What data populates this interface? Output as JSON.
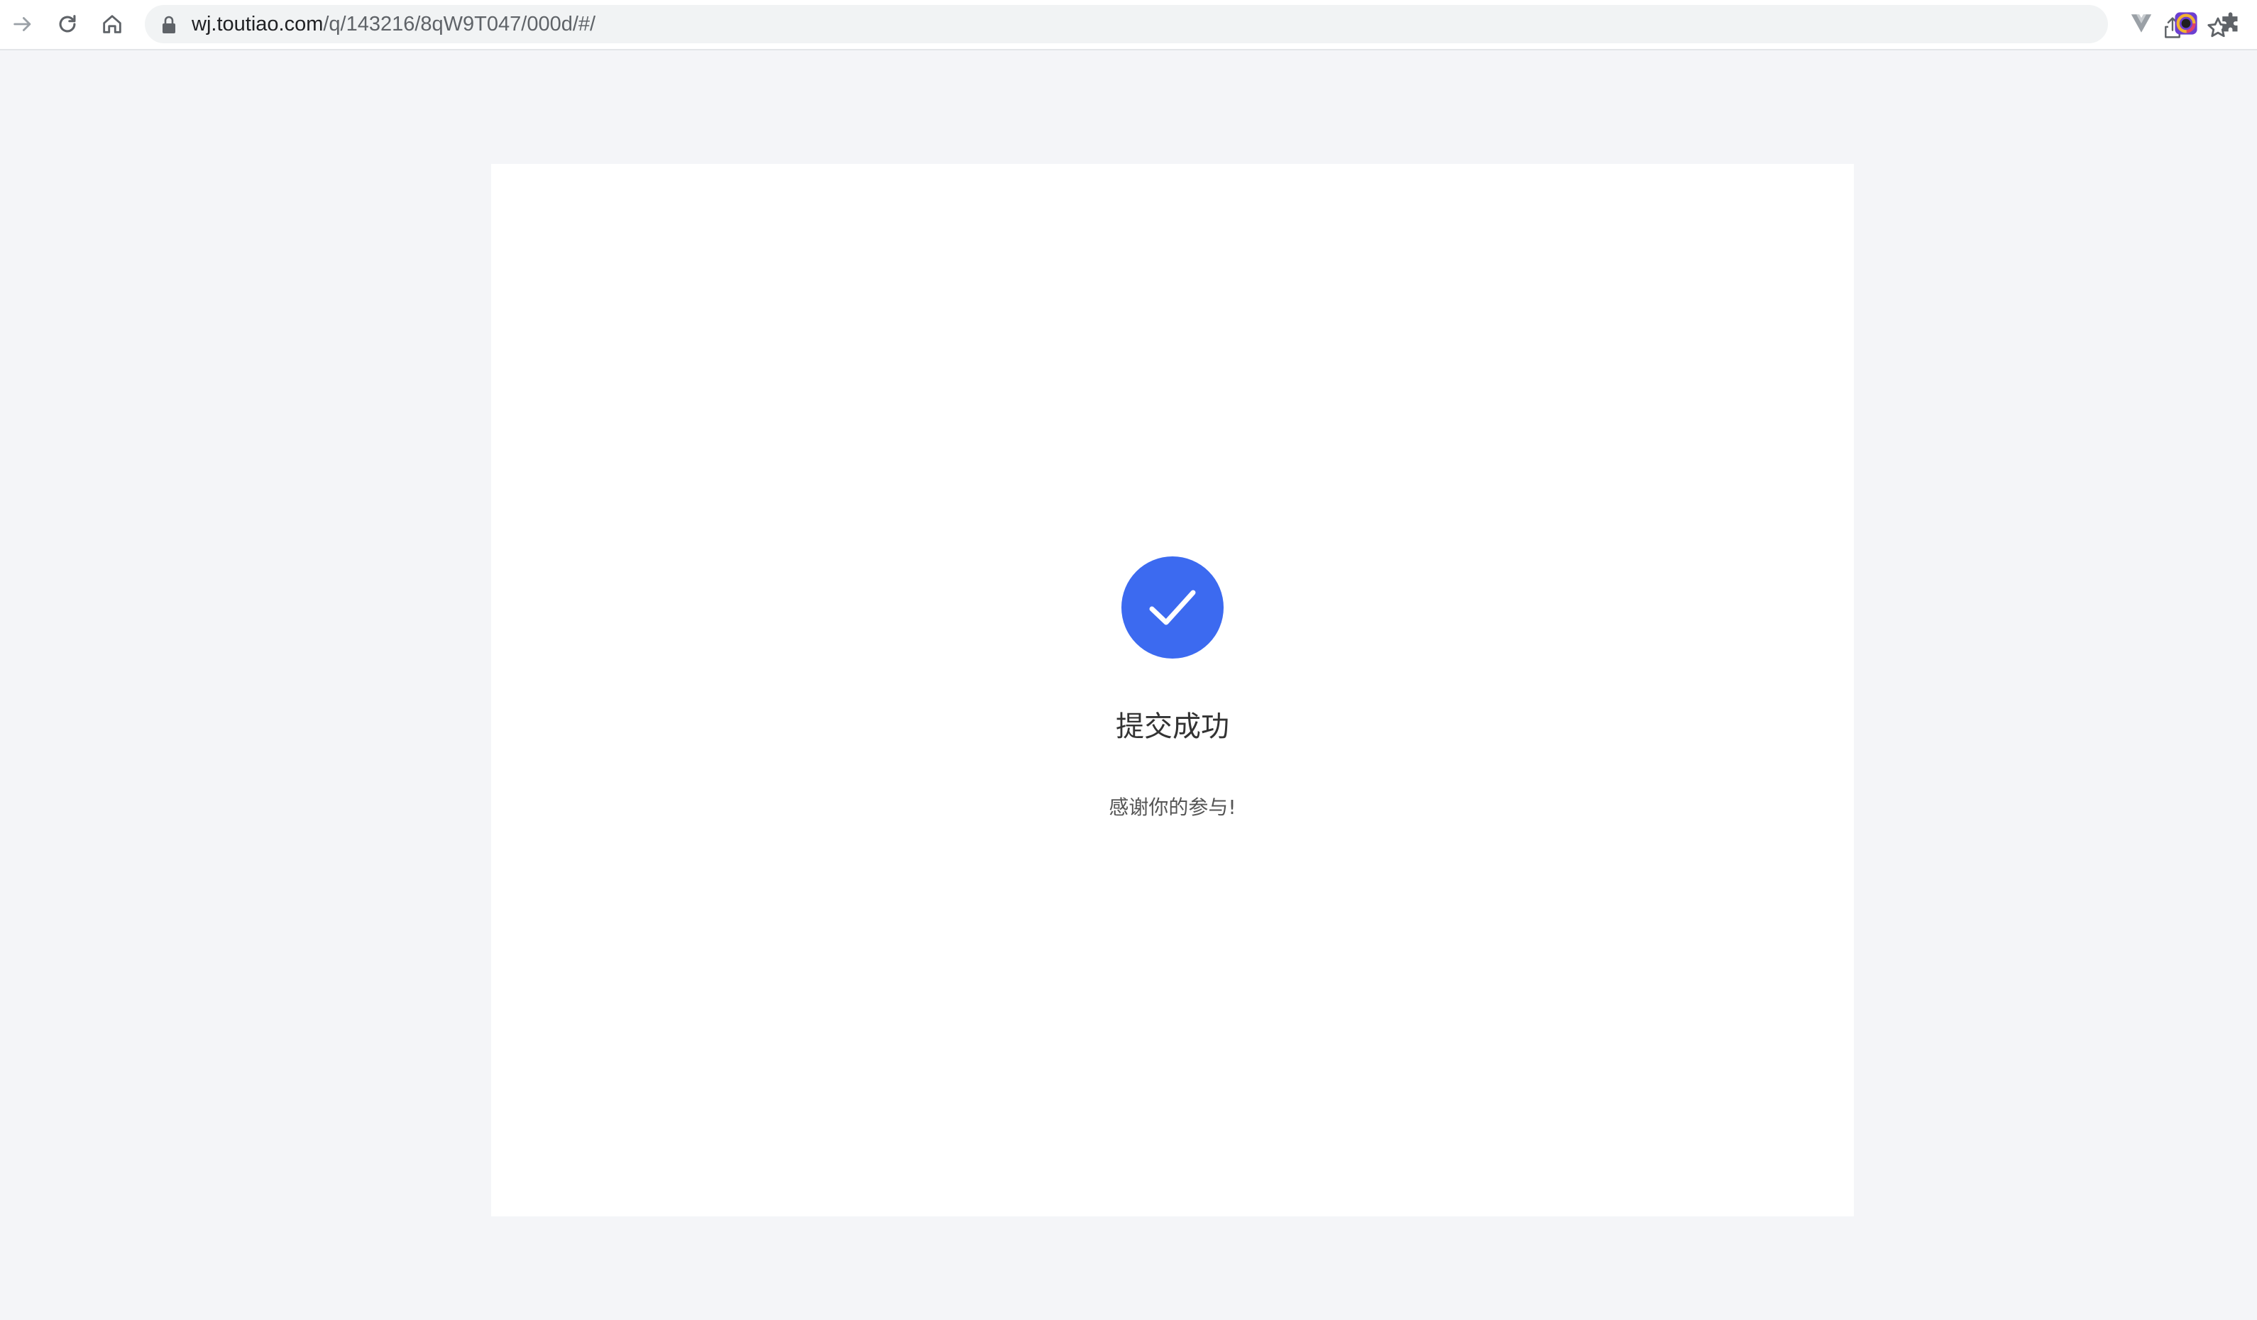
{
  "browser": {
    "url_host": "wj.toutiao.com",
    "url_path": "/q/143216/8qW9T047/000d/#/",
    "icons": {
      "forward": "arrow-right-icon",
      "reload": "reload-icon",
      "home": "home-icon",
      "lock": "lock-icon",
      "share": "share-icon",
      "bookmark": "star-icon",
      "extensions": [
        "vue-devtools-icon",
        "color-picker-icon",
        "puzzle-icon"
      ]
    }
  },
  "result": {
    "title": "提交成功",
    "message": "感谢你的参与!",
    "icon": "check-circle-icon",
    "accent_color": "#3c6af0"
  }
}
